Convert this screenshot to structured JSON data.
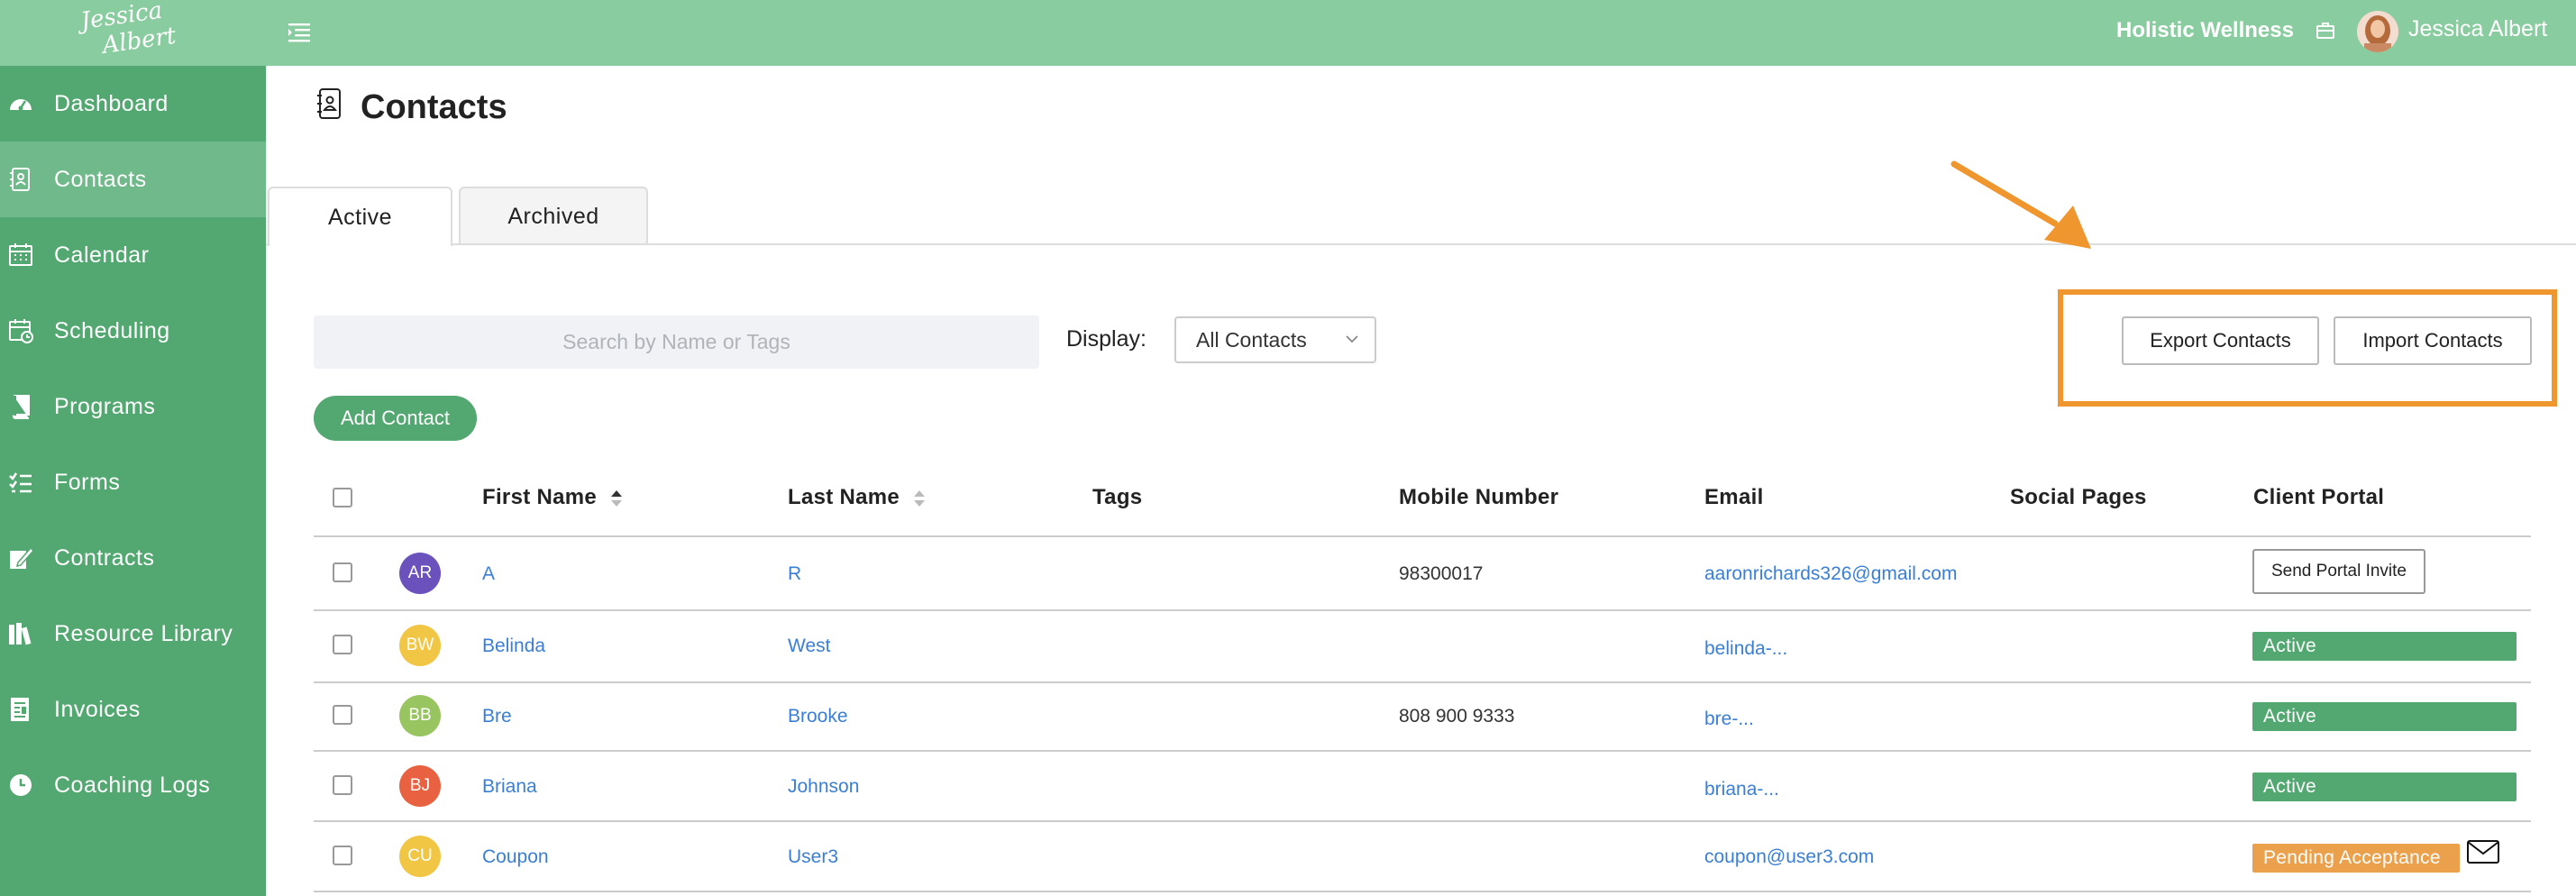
{
  "topbar": {
    "logo_line1": "Jessica",
    "logo_line2": "Albert",
    "org_name": "Holistic Wellness",
    "user_name": "Jessica Albert"
  },
  "sidebar": {
    "items": [
      {
        "label": "Dashboard",
        "icon": "dashboard-gauge-icon"
      },
      {
        "label": "Contacts",
        "icon": "contacts-book-icon",
        "active": true
      },
      {
        "label": "Calendar",
        "icon": "calendar-icon"
      },
      {
        "label": "Scheduling",
        "icon": "scheduling-calendar-icon"
      },
      {
        "label": "Programs",
        "icon": "book-icon"
      },
      {
        "label": "Forms",
        "icon": "checklist-icon"
      },
      {
        "label": "Contracts",
        "icon": "contract-sign-icon"
      },
      {
        "label": "Resource Library",
        "icon": "books-icon"
      },
      {
        "label": "Invoices",
        "icon": "invoice-icon"
      },
      {
        "label": "Coaching Logs",
        "icon": "clock-icon"
      }
    ]
  },
  "page": {
    "title": "Contacts",
    "tabs": [
      {
        "label": "Active",
        "active": true
      },
      {
        "label": "Archived",
        "active": false
      }
    ]
  },
  "toolbar": {
    "search_placeholder": "Search by Name or Tags",
    "display_label": "Display:",
    "display_value": "All Contacts",
    "add_contact": "Add Contact",
    "export_contacts": "Export Contacts",
    "import_contacts": "Import Contacts"
  },
  "table": {
    "headers": [
      "First Name",
      "Last Name",
      "Tags",
      "Mobile Number",
      "Email",
      "Social Pages",
      "Client Portal"
    ],
    "rows": [
      {
        "initials": "AR",
        "avatar_color": "#5b3fb5",
        "first": "A",
        "last": "R",
        "mobile": "98300017",
        "email": "aaronrichards326@gmail.com",
        "portal_button": "Send Portal Invite"
      },
      {
        "initials": "BW",
        "avatar_color": "#f0c030",
        "first": "Belinda",
        "last": "West",
        "mobile": "",
        "email": "belinda-...",
        "portal_status": "Active"
      },
      {
        "initials": "BB",
        "avatar_color": "#8fbf50",
        "first": "Bre",
        "last": "Brooke",
        "mobile": "808 900 9333",
        "email": "bre-...",
        "portal_status": "Active"
      },
      {
        "initials": "BJ",
        "avatar_color": "#e6512d",
        "first": "Briana",
        "last": "Johnson",
        "mobile": "",
        "email": "briana-...",
        "portal_status": "Active"
      },
      {
        "initials": "CU",
        "avatar_color": "#f0c030",
        "first": "Coupon",
        "last": "User3",
        "mobile": "",
        "email": "coupon@user3.com",
        "portal_status": "Pending Acceptance"
      }
    ]
  },
  "colors": {
    "topbar": "#89cc9f",
    "sidebar": "#52a870",
    "sidebar_active": "#6fb98a",
    "accent": "#52a870",
    "highlight": "#f0962e",
    "link": "#3a7fd5",
    "pending": "#eba04b"
  }
}
